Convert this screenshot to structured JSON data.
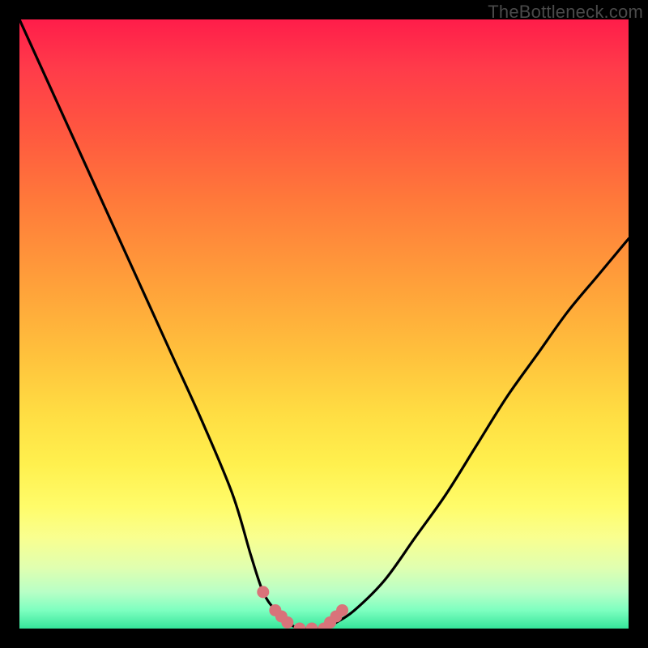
{
  "watermark": "TheBottleneck.com",
  "colors": {
    "frame_bg": "#000000",
    "curve_stroke": "#000000",
    "marker_fill": "#d9737a",
    "gradient_top": "#ff1d4a",
    "gradient_bottom": "#35e59a"
  },
  "chart_data": {
    "type": "line",
    "title": "",
    "xlabel": "",
    "ylabel": "",
    "xlim": [
      0,
      100
    ],
    "ylim": [
      0,
      100
    ],
    "x": [
      0,
      5,
      10,
      15,
      20,
      25,
      30,
      35,
      38,
      40,
      42,
      44,
      46,
      48,
      50,
      52,
      55,
      60,
      65,
      70,
      75,
      80,
      85,
      90,
      95,
      100
    ],
    "values": [
      100,
      89,
      78,
      67,
      56,
      45,
      34,
      22,
      12,
      6,
      3,
      1,
      0,
      0,
      0,
      1,
      3,
      8,
      15,
      22,
      30,
      38,
      45,
      52,
      58,
      64
    ],
    "markers": {
      "x": [
        40,
        42,
        43,
        44,
        46,
        48,
        50,
        51,
        52,
        53
      ],
      "y": [
        6,
        3,
        2,
        1,
        0,
        0,
        0,
        1,
        2,
        3
      ]
    },
    "note": "Axes unlabeled in source; x and y normalized 0–100 from pixel positions. Curve depicts a V-shaped bottleneck with minimum near x≈47."
  }
}
